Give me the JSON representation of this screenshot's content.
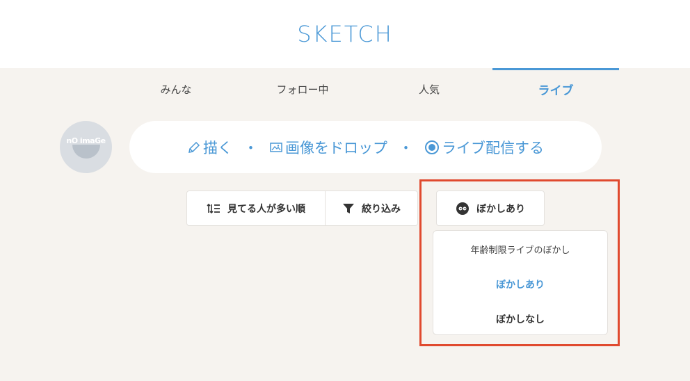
{
  "header": {
    "brand": "SKETCH"
  },
  "tabs": [
    {
      "label": "みんな"
    },
    {
      "label": "フォロー中"
    },
    {
      "label": "人気"
    },
    {
      "label": "ライブ",
      "active": true
    }
  ],
  "avatar": {
    "text": "nO imaGe"
  },
  "compose": {
    "draw_label": "描く",
    "drop_label": "画像をドロップ",
    "live_label": "ライブ配信する",
    "separator": "・"
  },
  "controls": {
    "sort_label": "見てる人が多い順",
    "filter_label": "絞り込み",
    "blur_label": "ぼかしあり"
  },
  "dropdown": {
    "title": "年齢制限ライブのぼかし",
    "option_on": "ぼかしあり",
    "option_off": "ぼかしなし"
  },
  "colors": {
    "accent": "#4a98d6",
    "highlight": "#e04a2f",
    "background": "#f6f3ef"
  }
}
